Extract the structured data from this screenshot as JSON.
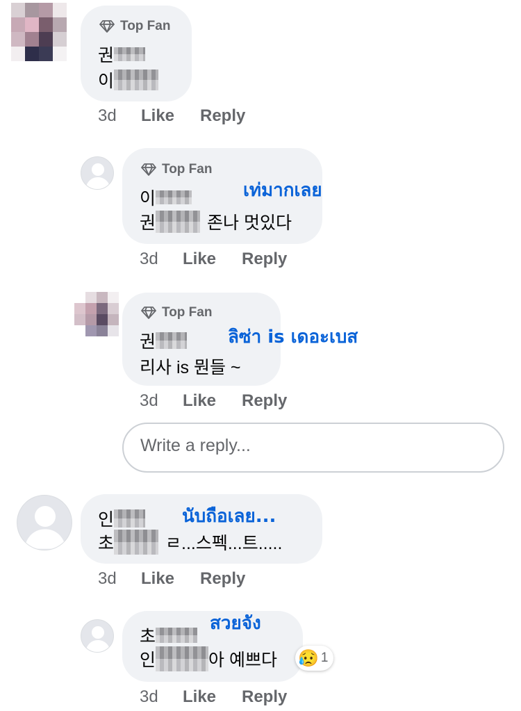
{
  "top_fan_label": "Top Fan",
  "actions": {
    "time": "3d",
    "like": "Like",
    "reply": "Reply"
  },
  "comments": [
    {
      "badge": "Top Fan",
      "line1_prefix": "권",
      "line2_prefix": "이",
      "line2_text": ""
    },
    {
      "badge": "Top Fan",
      "line1_prefix": "이",
      "line2_prefix": "권",
      "line2_text": "존나 멋있다",
      "annotation": "เท่มากเลย"
    },
    {
      "badge": "Top Fan",
      "line1_prefix": "권",
      "line2_text": "리사 is 뭔들 ~",
      "annotation": "ลิซ่า is เดอะเบส"
    },
    {
      "line1_prefix": "인",
      "line2_prefix": "초",
      "line2_text": "ㄹ...스펙...트.....",
      "annotation": "นับถือเลย..."
    },
    {
      "line1_prefix": "초",
      "line2_prefix": "인",
      "line2_text": "아 예쁘다",
      "annotation": "สวยจัง",
      "reaction_emoji": "😥",
      "reaction_count": "1"
    }
  ],
  "reply_input": {
    "placeholder": "Write a reply..."
  },
  "icons": {
    "badge": "diamond-icon",
    "avatar": "user-avatar-icon"
  }
}
